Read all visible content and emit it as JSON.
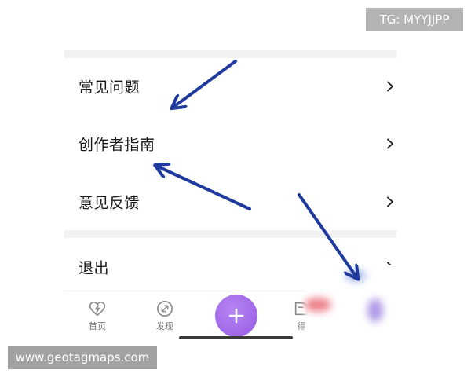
{
  "watermarks": {
    "top_right": "TG: MYYJJPP",
    "bottom_left": "www.geotagmaps.com"
  },
  "menu": {
    "items": [
      {
        "label": "常见问题",
        "icon": "chevron-right-icon"
      },
      {
        "label": "创作者指南",
        "icon": "chevron-right-icon"
      },
      {
        "label": "意见反馈",
        "icon": "chevron-right-icon"
      },
      {
        "label": "退出",
        "icon": "chevron-right-icon"
      }
    ]
  },
  "tab_bar": {
    "items": [
      {
        "label": "首页",
        "icon": "heart-bolt-icon"
      },
      {
        "label": "发现",
        "icon": "compass-icon"
      },
      {
        "icon": "plus-icon"
      },
      {
        "label": "得",
        "icon": "box-icon"
      }
    ]
  },
  "colors": {
    "background": "#ffffff",
    "separator": "#f2f2f2",
    "text_primary": "#1a1a1a",
    "tab_icon": "#8a8a8a",
    "tab_label": "#707070",
    "accent_purple": "#a066e8",
    "arrow_blue": "#1f3a9e",
    "watermark_top_bg": "#b4b4b4",
    "watermark_bottom_bg": "#a2a2a2"
  }
}
